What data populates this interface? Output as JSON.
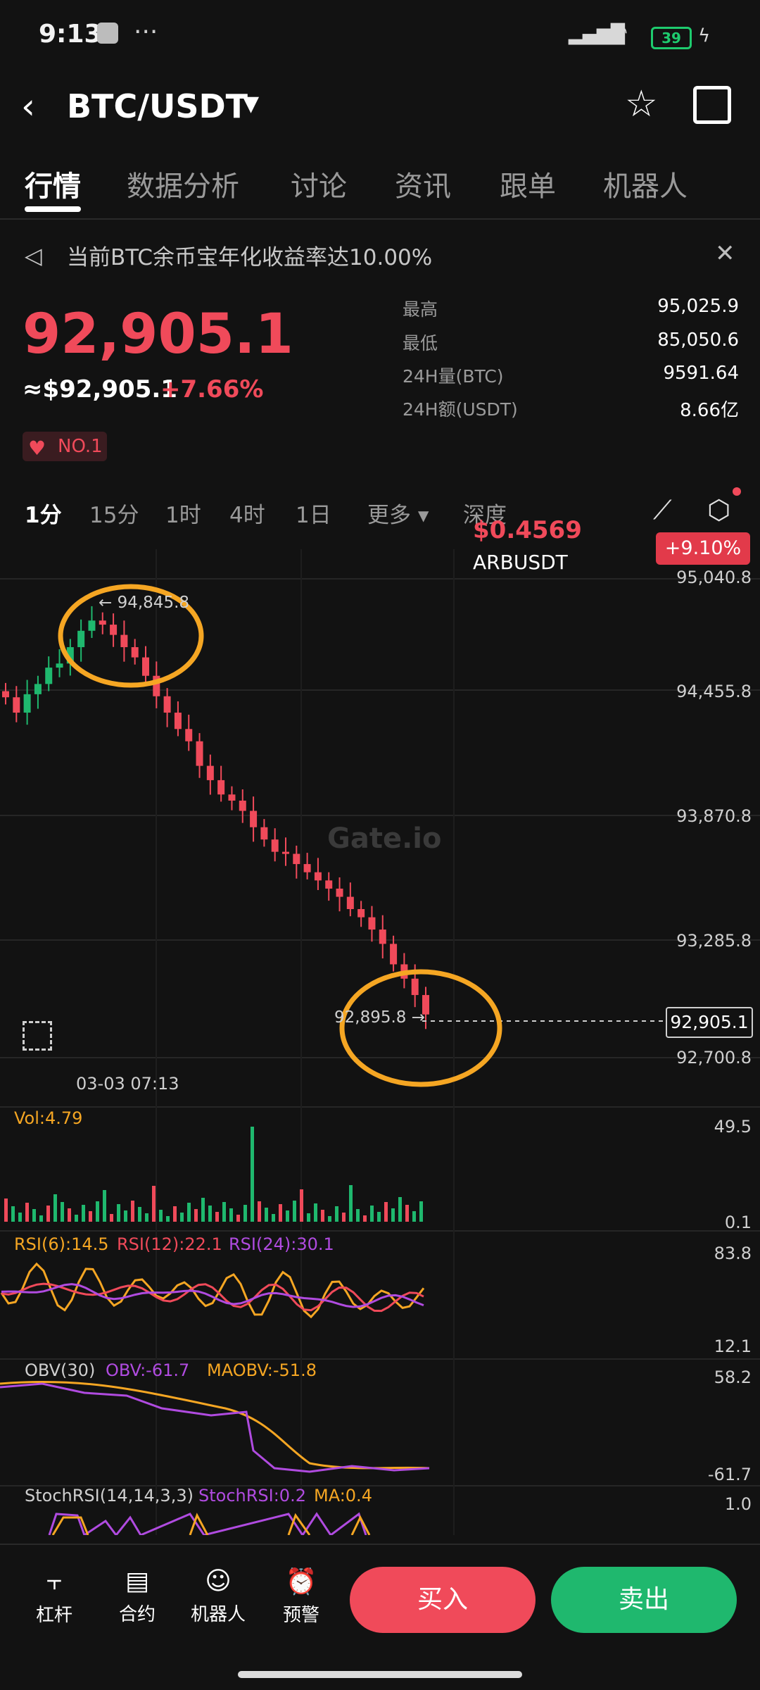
{
  "status": {
    "time": "9:13",
    "dots": "···",
    "battery": "39"
  },
  "header": {
    "back": "‹",
    "pair": "BTC/USDT",
    "caret": "▼",
    "favorite_icon": "star-icon",
    "share_icon": "share-icon"
  },
  "tabs": [
    {
      "label": "行情",
      "active": true
    },
    {
      "label": "数据分析"
    },
    {
      "label": "讨论"
    },
    {
      "label": "资讯"
    },
    {
      "label": "跟单"
    },
    {
      "label": "机器人"
    }
  ],
  "notice": {
    "text": "当前BTC余币宝年化收益率达10.00%",
    "close": "✕"
  },
  "ticker": {
    "price": "92,905.1",
    "approx": "≈$92,905.1",
    "change": "+7.66%",
    "rank_badge": "NO.1",
    "stats": [
      {
        "label": "最高",
        "value": "95,025.9"
      },
      {
        "label": "最低",
        "value": "85,050.6"
      },
      {
        "label": "24H量(BTC)",
        "value": "9591.64"
      },
      {
        "label": "24H额(USDT)",
        "value": "8.66亿"
      }
    ]
  },
  "intervals": {
    "items": [
      "1分",
      "15分",
      "1时",
      "4时",
      "1日",
      "更多 ▾",
      "深度"
    ],
    "active": "1分"
  },
  "floating_ticker": {
    "price": "$0.4569",
    "symbol": "ARBUSDT",
    "change": "+9.10%"
  },
  "chart_data": {
    "type": "candlestick",
    "interval": "1分",
    "y_axis_ticks": [
      "95,040.8",
      "94,455.8",
      "93,870.8",
      "93,285.8",
      "92,700.8"
    ],
    "ylim": [
      92700.8,
      95040.8
    ],
    "high_marker": "94,845.8",
    "low_marker": "92,895.8",
    "current_price": "92,905.1",
    "date_label": "03-03 07:13",
    "watermark": "Gate.io",
    "close_series": [
      94455,
      94380,
      94470,
      94520,
      94600,
      94620,
      94700,
      94780,
      94830,
      94810,
      94760,
      94700,
      94650,
      94560,
      94460,
      94380,
      94300,
      94240,
      94120,
      94050,
      93980,
      93950,
      93900,
      93820,
      93760,
      93700,
      93690,
      93640,
      93600,
      93560,
      93520,
      93480,
      93420,
      93380,
      93320,
      93250,
      93150,
      93080,
      93000,
      92905
    ],
    "volume": {
      "label": "Vol:4.79",
      "axis_max": "49.5",
      "axis_min": "0.1"
    },
    "rsi": {
      "labels": [
        "RSI(6):14.5",
        "RSI(12):22.1",
        "RSI(24):30.1"
      ],
      "axis_max": "83.8",
      "axis_min": "12.1"
    },
    "obv": {
      "labels": [
        "OBV(30)",
        "OBV:-61.7",
        "MAOBV:-51.8"
      ],
      "axis_max": "58.2",
      "axis_min": "-61.7"
    },
    "stochrsi": {
      "labels": [
        "StochRSI(14,14,3,3)",
        "StochRSI:0.2",
        "MA:0.4"
      ],
      "axis_max": "1.0"
    }
  },
  "bottom_nav": [
    {
      "icon": "leverage-icon",
      "label": "杠杆"
    },
    {
      "icon": "contract-icon",
      "label": "合约"
    },
    {
      "icon": "robot-icon",
      "label": "机器人"
    },
    {
      "icon": "alert-icon",
      "label": "预警"
    }
  ],
  "actions": {
    "buy": "买入",
    "sell": "卖出"
  },
  "colors": {
    "up": "#f04a5a",
    "down": "#1fb86e",
    "highlight": "#f5a623"
  }
}
